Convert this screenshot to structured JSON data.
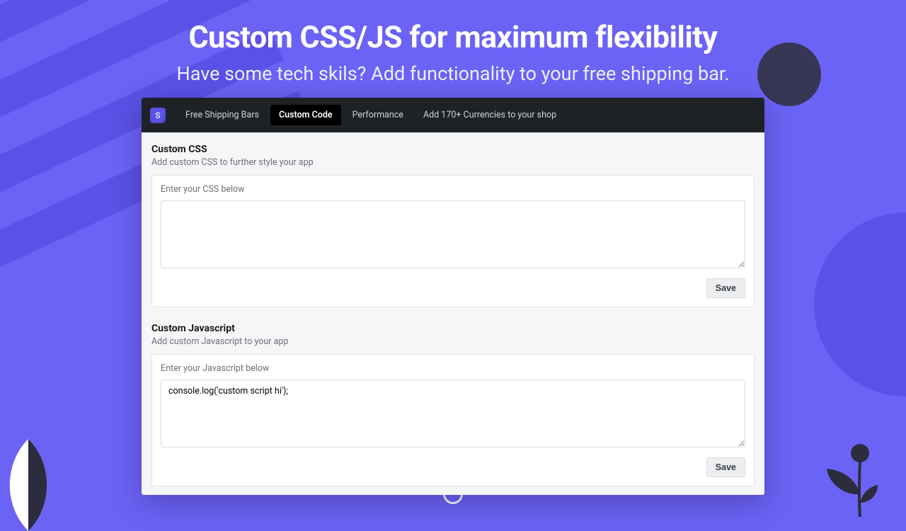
{
  "hero": {
    "title": "Custom CSS/JS for maximum flexibility",
    "subtitle": "Have some tech skils? Add functionality to your free shipping bar."
  },
  "nav": {
    "items": [
      {
        "label": "Free Shipping Bars",
        "active": false
      },
      {
        "label": "Custom Code",
        "active": true
      },
      {
        "label": "Performance",
        "active": false
      },
      {
        "label": "Add 170+ Currencies to your shop",
        "active": false
      }
    ]
  },
  "css_section": {
    "title": "Custom CSS",
    "desc": "Add custom CSS to further style your app",
    "panel_label": "Enter your CSS below",
    "value": "",
    "save_label": "Save"
  },
  "js_section": {
    "title": "Custom Javascript",
    "desc": "Add custom Javascript to your app",
    "panel_label": "Enter your Javascript below",
    "value": "console.log('custom script hi');",
    "save_label": "Save"
  }
}
